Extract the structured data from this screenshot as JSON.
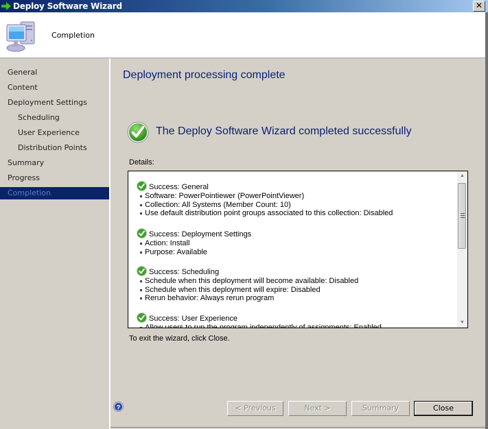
{
  "window": {
    "title": "Deploy Software Wizard",
    "close_glyph": "✕"
  },
  "header": {
    "title": "Completion",
    "icon": "computer-icon"
  },
  "sidebar": {
    "items": [
      {
        "label": "General",
        "level": 0,
        "active": false
      },
      {
        "label": "Content",
        "level": 0,
        "active": false
      },
      {
        "label": "Deployment Settings",
        "level": 0,
        "active": false
      },
      {
        "label": "Scheduling",
        "level": 1,
        "active": false
      },
      {
        "label": "User Experience",
        "level": 1,
        "active": false
      },
      {
        "label": "Distribution Points",
        "level": 1,
        "active": false
      },
      {
        "label": "Summary",
        "level": 0,
        "active": false
      },
      {
        "label": "Progress",
        "level": 0,
        "active": false
      },
      {
        "label": "Completion",
        "level": 0,
        "active": true
      }
    ]
  },
  "main": {
    "page_title": "Deployment processing complete",
    "success_message": "The Deploy Software Wizard completed successfully",
    "details_label": "Details:",
    "details": [
      {
        "heading": "Success: General",
        "items": [
          "Software: PowerPointiewer (PowerPointViewer)",
          "Collection: All Systems (Member Count: 10)",
          "Use default distribution point groups associated to this collection: Disabled"
        ]
      },
      {
        "heading": "Success: Deployment Settings",
        "items": [
          "Action: Install",
          "Purpose: Available"
        ]
      },
      {
        "heading": "Success: Scheduling",
        "items": [
          "Schedule when this deployment will become available: Disabled",
          "Schedule when this deployment will expire: Disabled",
          "Rerun behavior: Always rerun program"
        ]
      },
      {
        "heading": "Success: User Experience",
        "items": [
          "Allow users to run the program independently of assignments: Enabled"
        ]
      }
    ],
    "scroll_position_fraction": 0,
    "exit_text": "To exit the wizard, click Close."
  },
  "footer": {
    "help_icon": "help-icon",
    "buttons": {
      "previous": "< Previous",
      "next": "Next >",
      "summary": "Summary",
      "close": "Close"
    }
  },
  "colors": {
    "title_text": "#0a1e7a",
    "active_nav_bg": "#0a246a",
    "dialog_bg": "#d4d0c8",
    "success_green": "#3fa22a"
  }
}
